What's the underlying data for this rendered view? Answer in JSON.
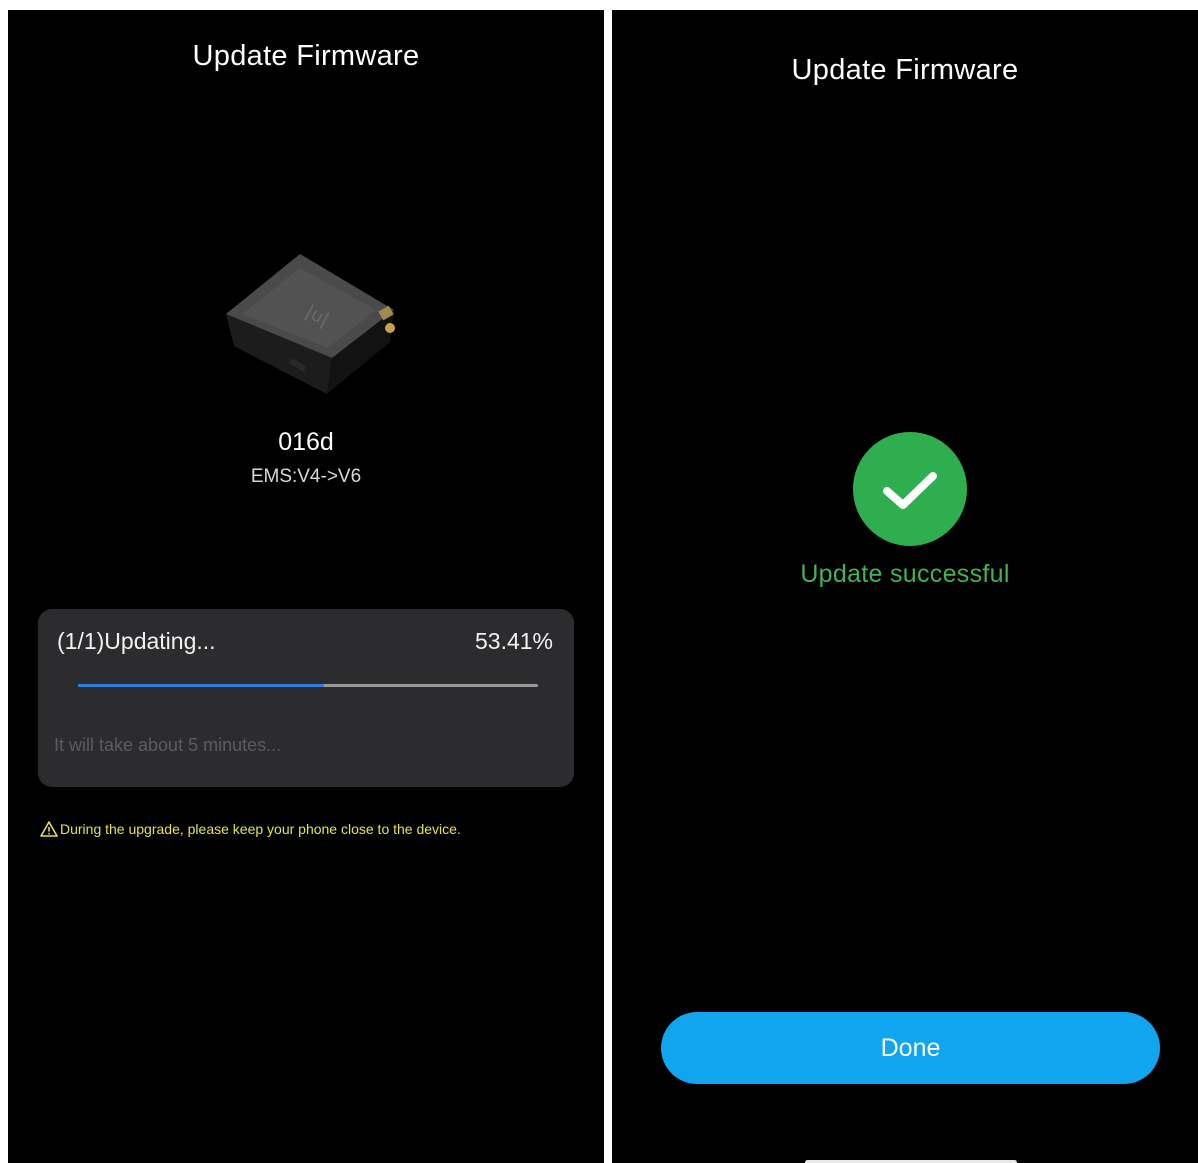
{
  "left_screen": {
    "title": "Update Firmware",
    "device": {
      "name": "016d",
      "version": "EMS:V4->V6"
    },
    "progress": {
      "status": "(1/1)Updating...",
      "percent_label": "53.41%",
      "percent": 53.41,
      "eta": "It will take about 5 minutes..."
    },
    "warning": "During the upgrade, please keep your phone close to the device.",
    "warning_icon": "warning-triangle-icon"
  },
  "right_screen": {
    "title": "Update Firmware",
    "success_message": "Update successful",
    "success_icon": "check-circle-icon",
    "done_label": "Done"
  },
  "colors": {
    "background": "#000000",
    "card": "#2c2c2e",
    "progress": "#2b7fe0",
    "warning": "#e8e04a",
    "success": "#2fae4f",
    "done_button": "#10a5ee"
  }
}
